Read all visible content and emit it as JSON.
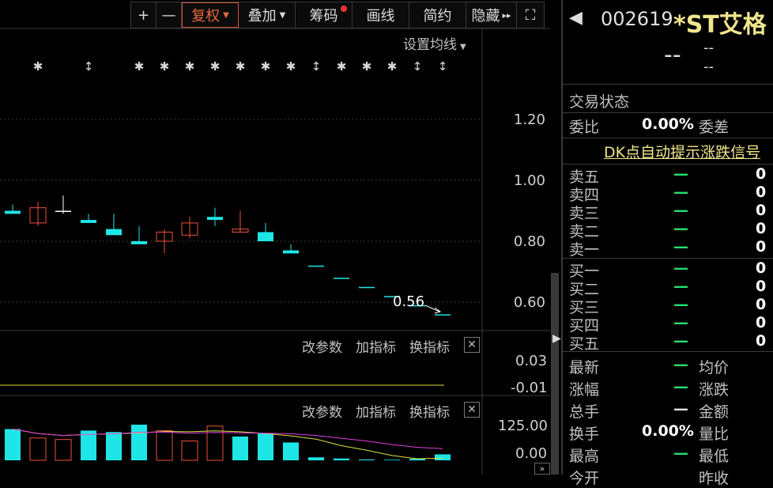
{
  "toolbar": {
    "plus": "+",
    "minus": "—",
    "fuquan": "复权",
    "diejia": "叠加",
    "chouma": "筹码",
    "huaxian": "画线",
    "jianyue": "简约",
    "yincang": "隐藏",
    "more": "▸▸",
    "expand": "⛶"
  },
  "kline": {
    "ma_setting": "设置均线",
    "y_ticks": [
      "1.20",
      "1.00",
      "0.80",
      "0.60"
    ],
    "price_label": "0.56",
    "candles": [
      {
        "o": 0.9,
        "h": 0.92,
        "l": 0.89,
        "c": 0.89,
        "dir": "down"
      },
      {
        "o": 0.86,
        "h": 0.93,
        "l": 0.85,
        "c": 0.91,
        "dir": "up"
      },
      {
        "o": 0.9,
        "h": 0.95,
        "l": 0.89,
        "c": 0.9,
        "dir": "flat"
      },
      {
        "o": 0.87,
        "h": 0.89,
        "l": 0.86,
        "c": 0.86,
        "dir": "down"
      },
      {
        "o": 0.84,
        "h": 0.89,
        "l": 0.82,
        "c": 0.82,
        "dir": "down"
      },
      {
        "o": 0.8,
        "h": 0.85,
        "l": 0.79,
        "c": 0.79,
        "dir": "down"
      },
      {
        "o": 0.8,
        "h": 0.84,
        "l": 0.76,
        "c": 0.83,
        "dir": "up"
      },
      {
        "o": 0.82,
        "h": 0.88,
        "l": 0.81,
        "c": 0.86,
        "dir": "up"
      },
      {
        "o": 0.88,
        "h": 0.91,
        "l": 0.85,
        "c": 0.87,
        "dir": "down"
      },
      {
        "o": 0.83,
        "h": 0.9,
        "l": 0.83,
        "c": 0.84,
        "dir": "up"
      },
      {
        "o": 0.83,
        "h": 0.86,
        "l": 0.8,
        "c": 0.8,
        "dir": "down"
      },
      {
        "o": 0.77,
        "h": 0.79,
        "l": 0.76,
        "c": 0.76,
        "dir": "down"
      },
      {
        "o": 0.72,
        "h": 0.72,
        "l": 0.72,
        "c": 0.72,
        "dir": "down"
      },
      {
        "o": 0.68,
        "h": 0.68,
        "l": 0.68,
        "c": 0.68,
        "dir": "down"
      },
      {
        "o": 0.65,
        "h": 0.65,
        "l": 0.65,
        "c": 0.65,
        "dir": "down"
      },
      {
        "o": 0.62,
        "h": 0.62,
        "l": 0.62,
        "c": 0.62,
        "dir": "down"
      },
      {
        "o": 0.59,
        "h": 0.59,
        "l": 0.59,
        "c": 0.59,
        "dir": "down"
      },
      {
        "o": 0.56,
        "h": 0.56,
        "l": 0.56,
        "c": 0.56,
        "dir": "down"
      }
    ],
    "markers": [
      "✱",
      "✱",
      "↕",
      "✱",
      "✱",
      "✱",
      "✱",
      "✱",
      "✱",
      "✱",
      "↕",
      "✱",
      "✱",
      "✱",
      "↕",
      "↕"
    ]
  },
  "panel2": {
    "gaicanshu": "改参数",
    "jiazhibiao": "加指标",
    "huanzhibiao": "换指标",
    "close": "✕",
    "y_ticks": [
      "0.03",
      "-0.01"
    ]
  },
  "panel3": {
    "gaicanshu": "改参数",
    "jiazhibiao": "加指标",
    "huanzhibiao": "换指标",
    "close": "✕",
    "y_ticks": [
      "125.00",
      "0.00"
    ],
    "volumes": [
      105,
      75,
      70,
      100,
      95,
      120,
      100,
      65,
      115,
      80,
      90,
      60,
      10,
      6,
      3,
      2,
      5,
      20
    ],
    "vol_dir": [
      "down",
      "up",
      "up",
      "down",
      "down",
      "down",
      "up",
      "up",
      "up",
      "down",
      "down",
      "down",
      "down",
      "down",
      "down",
      "down",
      "down",
      "down"
    ]
  },
  "quote": {
    "code": "002619",
    "name": "*ST艾格",
    "price": "--",
    "change1": "--",
    "change2": "--",
    "trade_status": "交易状态",
    "weibi_label": "委比",
    "weibi_value": "0.00%",
    "weicha_label": "委差",
    "dk_link": "DK点自动提示涨跌信号",
    "sell": [
      {
        "label": "卖五",
        "price": "—",
        "vol": "0"
      },
      {
        "label": "卖四",
        "price": "—",
        "vol": "0"
      },
      {
        "label": "卖三",
        "price": "—",
        "vol": "0"
      },
      {
        "label": "卖二",
        "price": "—",
        "vol": "0"
      },
      {
        "label": "卖一",
        "price": "—",
        "vol": "0"
      }
    ],
    "buy": [
      {
        "label": "买一",
        "price": "—",
        "vol": "0"
      },
      {
        "label": "买二",
        "price": "—",
        "vol": "0"
      },
      {
        "label": "买三",
        "price": "—",
        "vol": "0"
      },
      {
        "label": "买四",
        "price": "—",
        "vol": "0"
      },
      {
        "label": "买五",
        "price": "—",
        "vol": "0"
      }
    ],
    "stats": [
      {
        "l1": "最新",
        "v1": "—",
        "l2": "均价"
      },
      {
        "l1": "涨幅",
        "v1": "—",
        "l2": "涨跌"
      },
      {
        "l1": "总手",
        "v1": "—",
        "l2": "金额"
      },
      {
        "l1": "换手",
        "v1": "0.00%",
        "l2": "量比"
      },
      {
        "l1": "最高",
        "v1": "—",
        "l2": "最低"
      },
      {
        "l1": "今开",
        "v1": "",
        "l2": "昨收"
      }
    ],
    "back_arrow": "◀"
  },
  "colors": {
    "up": "#f0503c",
    "down": "#1ee6e6",
    "green": "#24e070",
    "ma1": "#e0e040",
    "ma2": "#e040e0"
  }
}
